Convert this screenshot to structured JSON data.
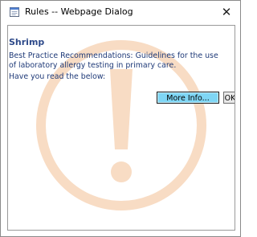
{
  "window": {
    "title": "Rules -- Webpage Dialog",
    "close_glyph": "✕",
    "app_icon": "document-icon"
  },
  "content": {
    "heading": "Shrimp",
    "description": "Best Practice Recommendations: Guidelines for the use of laboratory allergy testing in primary care.",
    "question": "Have you read the below:",
    "watermark_icon": "warning-exclamation-icon",
    "watermark_color": "#f6cfae"
  },
  "buttons": {
    "more_info_label": "More Info...",
    "ok_label": "OK"
  },
  "colors": {
    "heading": "#2e4a8a",
    "text": "#1f3a78",
    "more_info_bg": "#7fd6f5"
  }
}
